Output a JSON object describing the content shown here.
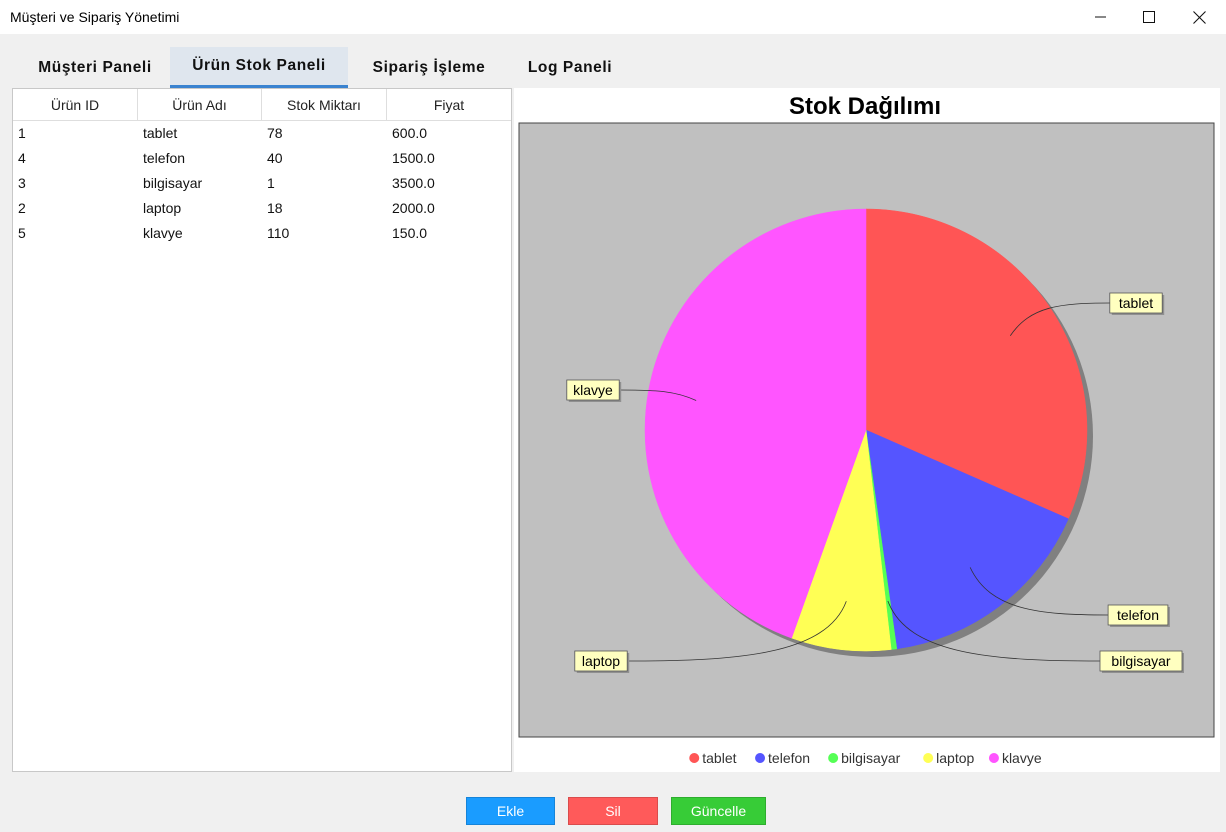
{
  "window": {
    "title": "Müşteri ve Sipariş Yönetimi"
  },
  "tabs": [
    {
      "label": "Müşteri Paneli",
      "active": false
    },
    {
      "label": "Ürün Stok Paneli",
      "active": true
    },
    {
      "label": "Sipariş İşleme",
      "active": false
    },
    {
      "label": "Log Paneli",
      "active": false
    }
  ],
  "table": {
    "columns": [
      "Ürün ID",
      "Ürün Adı",
      "Stok Miktarı",
      "Fiyat"
    ],
    "rows": [
      [
        "1",
        "tablet",
        "78",
        "600.0"
      ],
      [
        "4",
        "telefon",
        "40",
        "1500.0"
      ],
      [
        "3",
        "bilgisayar",
        "1",
        "3500.0"
      ],
      [
        "2",
        "laptop",
        "18",
        "2000.0"
      ],
      [
        "5",
        "klavye",
        "110",
        "150.0"
      ]
    ]
  },
  "chart_data": {
    "type": "pie",
    "title": "Stok Dağılımı",
    "categories": [
      "tablet",
      "telefon",
      "bilgisayar",
      "laptop",
      "klavye"
    ],
    "values": [
      78,
      40,
      1,
      18,
      110
    ],
    "colors": [
      "#ff5555",
      "#5555ff",
      "#55ff55",
      "#ffff55",
      "#ff55ff"
    ],
    "plot_background": "#c0c0c0",
    "legend_position": "bottom",
    "start_angle": "12 o'clock",
    "direction": "clockwise"
  },
  "buttons": {
    "add": {
      "label": "Ekle",
      "color": "#1a9cff"
    },
    "delete": {
      "label": "Sil",
      "color": "#ff5a5a"
    },
    "update": {
      "label": "Güncelle",
      "color": "#37cc37"
    }
  }
}
